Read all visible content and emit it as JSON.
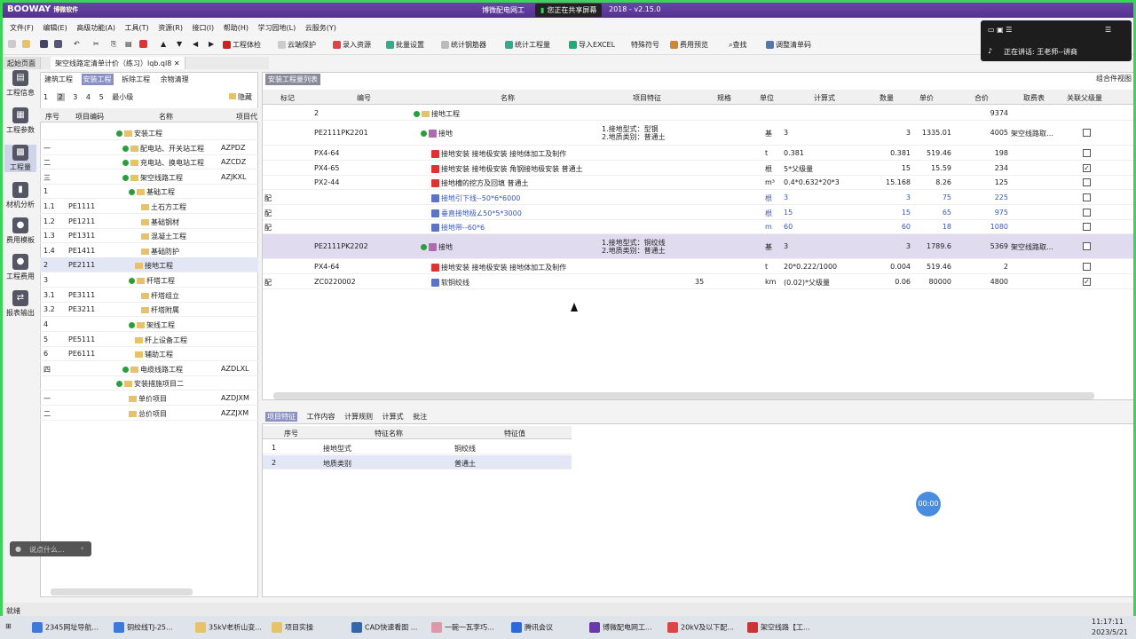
{
  "app": {
    "logo": "BOOWAY",
    "logo_sub": "博微软件",
    "title_left": "博微配电网工",
    "title_right": "2018 - v2.15.0",
    "sharing": "您正在共享屏幕"
  },
  "menu": [
    "文件(F)",
    "编辑(E)",
    "高级功能(A)",
    "工具(T)",
    "资源(R)",
    "接口(I)",
    "帮助(H)",
    "学习园地(L)",
    "云服务(Y)"
  ],
  "toolbar": [
    "工程体检",
    "云端保护",
    "录入资源",
    "批量设置",
    "统计钢筋器",
    "统计工程量",
    "导入EXCEL",
    "特殊符号",
    "费用预览",
    "查找",
    "调整清单码"
  ],
  "tabs": [
    "起始页面",
    "架空线路定清单计价（练习）lqb.ql8"
  ],
  "left_nav": [
    {
      "label": "工程信息",
      "icon": "document-icon"
    },
    {
      "label": "工程参数",
      "icon": "settings-doc-icon"
    },
    {
      "label": "工程量",
      "icon": "grid-icon"
    },
    {
      "label": "材机分析",
      "icon": "bar-chart-icon"
    },
    {
      "label": "费用模板",
      "icon": "template-icon"
    },
    {
      "label": "工程费用",
      "icon": "money-icon"
    },
    {
      "label": "报表输出",
      "icon": "report-icon"
    }
  ],
  "sub_tabs": [
    "建筑工程",
    "安装工程",
    "拆除工程",
    "余物清理"
  ],
  "levels": [
    "1",
    "2",
    "3",
    "4",
    "5",
    "最小级"
  ],
  "hide_label": "隐藏",
  "tree_headers": {
    "seq": "序号",
    "code": "项目编码",
    "name": "名称",
    "attr": "项目代"
  },
  "tree_rows": [
    {
      "seq": "",
      "code": "",
      "name": "安装工程",
      "attr": ""
    },
    {
      "seq": "一",
      "code": "",
      "name": "配电站、开关站工程",
      "attr": "AZPDZ"
    },
    {
      "seq": "二",
      "code": "",
      "name": "充电站、换电站工程",
      "attr": "AZCDZ"
    },
    {
      "seq": "三",
      "code": "",
      "name": "架空线路工程",
      "attr": "AZJKXL"
    },
    {
      "seq": "1",
      "code": "",
      "name": "基础工程",
      "attr": ""
    },
    {
      "seq": "1.1",
      "code": "PE1111",
      "name": "土石方工程",
      "attr": ""
    },
    {
      "seq": "1.2",
      "code": "PE1211",
      "name": "基础钢材",
      "attr": ""
    },
    {
      "seq": "1.3",
      "code": "PE1311",
      "name": "混凝土工程",
      "attr": ""
    },
    {
      "seq": "1.4",
      "code": "PE1411",
      "name": "基础防护",
      "attr": ""
    },
    {
      "seq": "2",
      "code": "PE2111",
      "name": "接地工程",
      "attr": ""
    },
    {
      "seq": "3",
      "code": "",
      "name": "杆塔工程",
      "attr": ""
    },
    {
      "seq": "3.1",
      "code": "PE3111",
      "name": "杆塔组立",
      "attr": ""
    },
    {
      "seq": "3.2",
      "code": "PE3211",
      "name": "杆塔附属",
      "attr": ""
    },
    {
      "seq": "4",
      "code": "",
      "name": "架线工程",
      "attr": ""
    },
    {
      "seq": "5",
      "code": "PE5111",
      "name": "杆上设备工程",
      "attr": ""
    },
    {
      "seq": "6",
      "code": "PE6111",
      "name": "辅助工程",
      "attr": ""
    },
    {
      "seq": "四",
      "code": "",
      "name": "电缆线路工程",
      "attr": "AZDLXL"
    },
    {
      "seq": "",
      "code": "",
      "name": "安装措施项目二",
      "attr": ""
    },
    {
      "seq": "一",
      "code": "",
      "name": "单价项目",
      "attr": "AZDJXM"
    },
    {
      "seq": "二",
      "code": "",
      "name": "总价项目",
      "attr": "AZZJXM"
    }
  ],
  "right_tab": "安装工程量列表",
  "combo": "组合件视图",
  "grid_headers": [
    "标记",
    "编号",
    "名称",
    "项目特征",
    "规格",
    "单位",
    "计算式",
    "数量",
    "单价",
    "合价",
    "取费表",
    "关联父级量"
  ],
  "grid_rows": [
    {
      "mark": "",
      "code": "2",
      "name": "接地工程",
      "feat": "",
      "spec": "",
      "unit": "",
      "formula": "",
      "qty": "",
      "price": "",
      "total": "9374",
      "fee": "",
      "check": ""
    },
    {
      "mark": "",
      "code": "PE2111PK2201",
      "name": "接地",
      "feat": "1.接地型式：型钢\n2.地质类别：普通土",
      "spec": "",
      "unit": "基",
      "formula": "3",
      "qty": "3",
      "price": "1335.01",
      "total": "4005",
      "fee": "架空线路取…",
      "check": "no"
    },
    {
      "mark": "",
      "code": "PX4-64",
      "name": "接地安装 接地极安装 接地体加工及制作",
      "feat": "",
      "spec": "",
      "unit": "t",
      "formula": "0.381",
      "qty": "0.381",
      "price": "519.46",
      "total": "198",
      "fee": "",
      "check": "no"
    },
    {
      "mark": "",
      "code": "PX4-65",
      "name": "接地安装 接地极安装 角钢接地极安装 普通土",
      "feat": "",
      "spec": "",
      "unit": "根",
      "formula": "5*父级量",
      "qty": "15",
      "price": "15.59",
      "total": "234",
      "fee": "",
      "check": "yes"
    },
    {
      "mark": "",
      "code": "PX2-44",
      "name": "接地槽的挖方及回填 普通土",
      "feat": "",
      "spec": "",
      "unit": "m³",
      "formula": "0.4*0.632*20*3",
      "qty": "15.168",
      "price": "8.26",
      "total": "125",
      "fee": "",
      "check": "no"
    },
    {
      "mark": "配",
      "code": "",
      "name": "接地引下线--50*6*6000",
      "feat": "",
      "spec": "",
      "unit": "根",
      "formula": "3",
      "qty": "3",
      "price": "75",
      "total": "225",
      "fee": "",
      "check": "no"
    },
    {
      "mark": "配",
      "code": "",
      "name": "垂直接地极∠50*5*3000",
      "feat": "",
      "spec": "",
      "unit": "根",
      "formula": "15",
      "qty": "15",
      "price": "65",
      "total": "975",
      "fee": "",
      "check": "no"
    },
    {
      "mark": "配",
      "code": "",
      "name": "接地带--60*6",
      "feat": "",
      "spec": "",
      "unit": "m",
      "formula": "60",
      "qty": "60",
      "price": "18",
      "total": "1080",
      "fee": "",
      "check": "no"
    },
    {
      "mark": "",
      "code": "PE2111PK2202",
      "name": "接地",
      "feat": "1.接地型式：铜绞线\n2.地质类别：普通土",
      "spec": "",
      "unit": "基",
      "formula": "3",
      "qty": "3",
      "price": "1789.6",
      "total": "5369",
      "fee": "架空线路取…",
      "check": "no"
    },
    {
      "mark": "",
      "code": "PX4-64",
      "name": "接地安装 接地极安装 接地体加工及制作",
      "feat": "",
      "spec": "",
      "unit": "t",
      "formula": "20*0.222/1000",
      "qty": "0.004",
      "price": "519.46",
      "total": "2",
      "fee": "",
      "check": "no"
    },
    {
      "mark": "配",
      "code": "ZC0220002",
      "name": "软铜绞线",
      "feat": "",
      "spec": "35",
      "unit": "km",
      "formula": "(0.02)*父级量",
      "qty": "0.06",
      "price": "80000",
      "total": "4800",
      "fee": "",
      "check": "yes"
    }
  ],
  "bottom_tabs": [
    "项目特征",
    "工作内容",
    "计算规则",
    "计算式",
    "批注"
  ],
  "feat_headers": [
    "序号",
    "特征名称",
    "特征值"
  ],
  "feat_rows": [
    {
      "seq": "1",
      "name": "接地型式",
      "value": "铜绞线"
    },
    {
      "seq": "2",
      "name": "地质类别",
      "value": "普通土"
    }
  ],
  "status": "就绪",
  "ask": "说点什么...",
  "timer": "00:00",
  "popup": {
    "speaking": "正在讲话: 王老师--讲商"
  },
  "taskbar": [
    "2345网址导航...",
    "铜绞线TJ-25...",
    "35kV老析山变...",
    "项目实操",
    "CAD快速看图 ...",
    "一碗一瓦李巧...",
    "腾讯会议",
    "博微配电网工...",
    "20kV及以下配...",
    "架空线路【工..."
  ],
  "clock": {
    "time": "11:17:11",
    "date": "2023/5/21"
  }
}
